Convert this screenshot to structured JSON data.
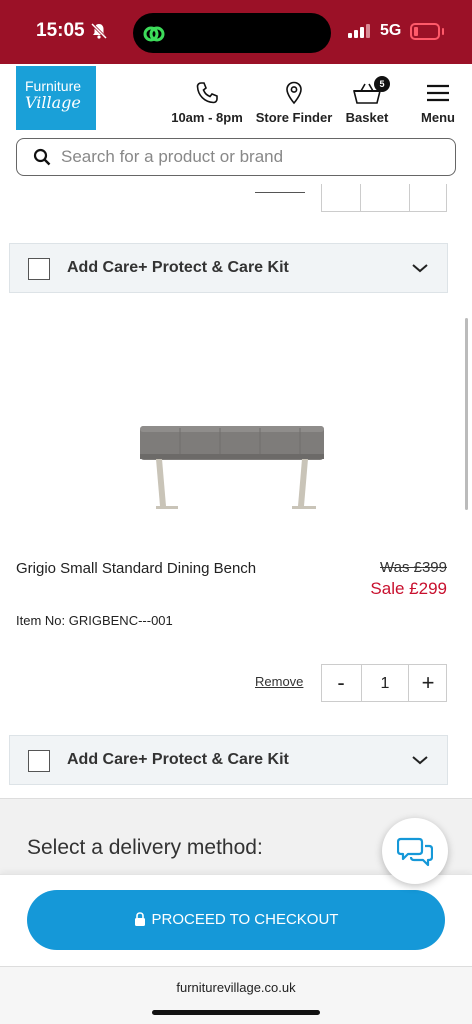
{
  "status": {
    "time": "15:05",
    "network": "5G"
  },
  "header": {
    "logo_line1": "Furniture",
    "logo_line2": "Village",
    "hours": "10am - 8pm",
    "store_finder": "Store Finder",
    "basket": "Basket",
    "basket_count": "5",
    "menu": "Menu",
    "icons": [
      "phone-icon",
      "location-pin-icon",
      "basket-icon",
      "hamburger-menu-icon",
      "search-icon"
    ]
  },
  "search": {
    "placeholder": "Search for a product or brand"
  },
  "care_plan": {
    "label": "Add Care+ Protect & Care Kit"
  },
  "product": {
    "name": "Grigio Small Standard Dining Bench",
    "was_price": "Was £399",
    "sale_price": "Sale £299",
    "item_no": "Item No: GRIGBENC---001",
    "remove": "Remove",
    "quantity": "1",
    "minus": "-",
    "plus": "+"
  },
  "delivery": {
    "title": "Select a delivery method:"
  },
  "checkout": {
    "label": "PROCEED TO CHECKOUT"
  },
  "browser": {
    "url": "furniturevillage.co.uk"
  },
  "colors": {
    "status_bar": "#9b1127",
    "brand_blue": "#1aa0d8",
    "checkout_blue": "#1598d8",
    "sale_red": "#c8102e"
  }
}
